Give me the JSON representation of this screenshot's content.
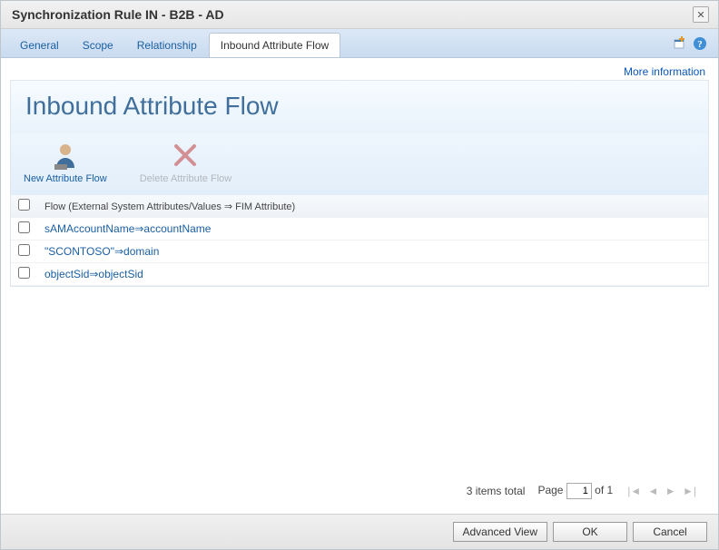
{
  "window": {
    "title": "Synchronization Rule IN - B2B - AD"
  },
  "tabs": {
    "general": "General",
    "scope": "Scope",
    "relationship": "Relationship",
    "inbound": "Inbound Attribute Flow"
  },
  "more_info": "More information",
  "panel": {
    "title": "Inbound Attribute Flow"
  },
  "toolbar": {
    "new_flow": "New Attribute Flow",
    "delete_flow": "Delete Attribute Flow"
  },
  "table": {
    "header": "Flow (External System Attributes/Values ⇒ FIM Attribute)",
    "rows": [
      "sAMAccountName⇒accountName",
      "\"SCONTOSO\"⇒domain",
      "objectSid⇒objectSid"
    ]
  },
  "pager": {
    "total_text": "3 items total",
    "page_label": "Page",
    "page_value": "1",
    "of_text": "of 1"
  },
  "buttons": {
    "advanced": "Advanced View",
    "ok": "OK",
    "cancel": "Cancel"
  }
}
